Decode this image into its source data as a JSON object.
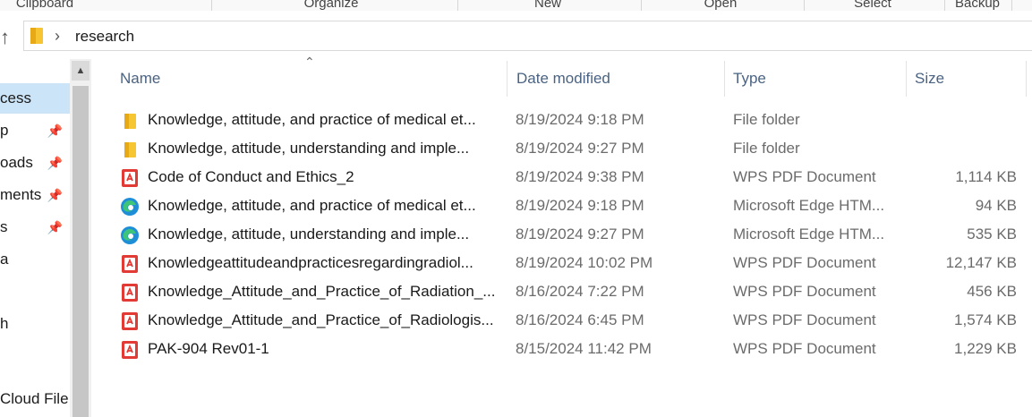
{
  "ribbon": {
    "groups": [
      "Clipboard",
      "Organize",
      "New",
      "Open",
      "Select",
      "Backup"
    ]
  },
  "address": {
    "breadcrumb": "research"
  },
  "nav": {
    "items": [
      {
        "label": "cess",
        "pinned": false,
        "selected": true
      },
      {
        "label": "p",
        "pinned": true
      },
      {
        "label": "oads",
        "pinned": true
      },
      {
        "label": "ments",
        "pinned": true
      },
      {
        "label": "s",
        "pinned": true
      },
      {
        "label": "a",
        "pinned": false
      },
      {
        "label": "",
        "pinned": false
      },
      {
        "label": "h",
        "pinned": false
      },
      {
        "label": "",
        "pinned": false
      },
      {
        "label": "Cloud File",
        "pinned": false
      }
    ]
  },
  "columns": {
    "name": "Name",
    "date": "Date modified",
    "type": "Type",
    "size": "Size"
  },
  "files": [
    {
      "icon": "folder-icon",
      "name": "Knowledge, attitude, and practice of medical et...",
      "date": "8/19/2024 9:18 PM",
      "type": "File folder",
      "size": ""
    },
    {
      "icon": "folder-icon",
      "name": "Knowledge, attitude, understanding and imple...",
      "date": "8/19/2024 9:27 PM",
      "type": "File folder",
      "size": ""
    },
    {
      "icon": "pdf-icon",
      "name": "Code of Conduct and Ethics_2",
      "date": "8/19/2024 9:38 PM",
      "type": "WPS PDF Document",
      "size": "1,114 KB"
    },
    {
      "icon": "edge-icon",
      "name": "Knowledge, attitude, and practice of medical et...",
      "date": "8/19/2024 9:18 PM",
      "type": "Microsoft Edge HTM...",
      "size": "94 KB"
    },
    {
      "icon": "edge-icon",
      "name": "Knowledge, attitude, understanding and imple...",
      "date": "8/19/2024 9:27 PM",
      "type": "Microsoft Edge HTM...",
      "size": "535 KB"
    },
    {
      "icon": "pdf-icon",
      "name": "Knowledgeattitudeandpracticesregardingradiol...",
      "date": "8/19/2024 10:02 PM",
      "type": "WPS PDF Document",
      "size": "12,147 KB"
    },
    {
      "icon": "pdf-icon",
      "name": "Knowledge_Attitude_and_Practice_of_Radiation_...",
      "date": "8/16/2024 7:22 PM",
      "type": "WPS PDF Document",
      "size": "456 KB"
    },
    {
      "icon": "pdf-icon",
      "name": "Knowledge_Attitude_and_Practice_of_Radiologis...",
      "date": "8/16/2024 6:45 PM",
      "type": "WPS PDF Document",
      "size": "1,574 KB"
    },
    {
      "icon": "pdf-icon",
      "name": "PAK-904 Rev01-1",
      "date": "8/15/2024 11:42 PM",
      "type": "WPS PDF Document",
      "size": "1,229 KB"
    }
  ],
  "colors": {
    "folder": "#f8c532",
    "pdf": "#e23a35",
    "edge": "#1e8fd6",
    "selected": "#cce4f7",
    "header_text": "#4a6382"
  }
}
